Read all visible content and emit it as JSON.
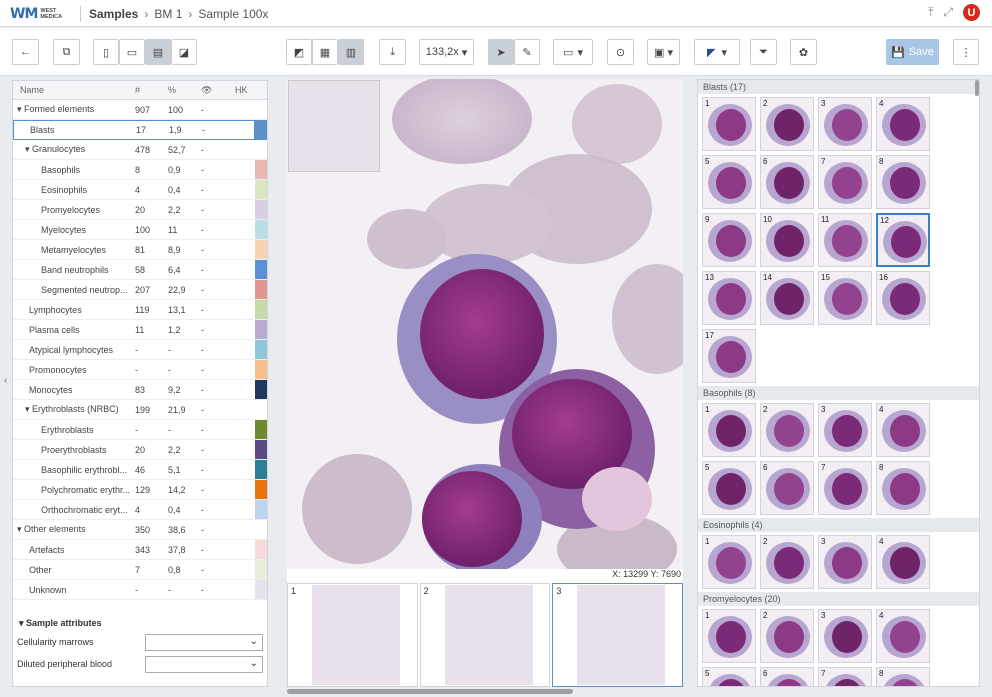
{
  "header": {
    "logo_mark": "WM",
    "logo_line1": "WEST",
    "logo_line2": "MEDICA",
    "crumb_root": "Samples",
    "crumb_mid": "BM 1",
    "crumb_current": "Sample 100x",
    "avatar_initial": "U"
  },
  "toolbar": {
    "zoom": "133,2x",
    "save_label": "Save"
  },
  "table": {
    "headers": {
      "name": "Name",
      "count": "#",
      "percent": "%",
      "visible": "👁",
      "hk": "HK"
    },
    "rows": [
      {
        "indent": 0,
        "caret": "▾",
        "name": "Formed elements",
        "count": "907",
        "percent": "100",
        "vis": "-",
        "color": ""
      },
      {
        "indent": 1,
        "caret": "",
        "name": "Blasts",
        "count": "17",
        "percent": "1,9",
        "vis": "-",
        "color": "#5b8fc8",
        "selected": true
      },
      {
        "indent": 1,
        "caret": "▾",
        "name": "Granulocytes",
        "count": "478",
        "percent": "52,7",
        "vis": "-",
        "color": ""
      },
      {
        "indent": 2,
        "caret": "",
        "name": "Basophils",
        "count": "8",
        "percent": "0,9",
        "vis": "-",
        "color": "#e7b8b4"
      },
      {
        "indent": 2,
        "caret": "",
        "name": "Eosinophils",
        "count": "4",
        "percent": "0,4",
        "vis": "-",
        "color": "#dbe5c0"
      },
      {
        "indent": 2,
        "caret": "",
        "name": "Promyelocytes",
        "count": "20",
        "percent": "2,2",
        "vis": "-",
        "color": "#d9cfe4"
      },
      {
        "indent": 2,
        "caret": "",
        "name": "Myelocytes",
        "count": "100",
        "percent": "11",
        "vis": "-",
        "color": "#b8dfe8"
      },
      {
        "indent": 2,
        "caret": "",
        "name": "Metamyelocytes",
        "count": "81",
        "percent": "8,9",
        "vis": "-",
        "color": "#f5d3b3"
      },
      {
        "indent": 2,
        "caret": "",
        "name": "Band neutrophils",
        "count": "58",
        "percent": "6,4",
        "vis": "-",
        "color": "#5b8fd6"
      },
      {
        "indent": 2,
        "caret": "",
        "name": "Segmented neutrop...",
        "count": "207",
        "percent": "22,9",
        "vis": "-",
        "color": "#e1958e"
      },
      {
        "indent": 1,
        "caret": "",
        "name": "Lymphocytes",
        "count": "119",
        "percent": "13,1",
        "vis": "-",
        "color": "#c5dba7"
      },
      {
        "indent": 1,
        "caret": "",
        "name": "Plasma cells",
        "count": "11",
        "percent": "1,2",
        "vis": "-",
        "color": "#b9abd1"
      },
      {
        "indent": 1,
        "caret": "",
        "name": "Atypical lymphocytes",
        "count": "-",
        "percent": "-",
        "vis": "-",
        "color": "#8cc7dc"
      },
      {
        "indent": 1,
        "caret": "",
        "name": "Promonocytes",
        "count": "-",
        "percent": "-",
        "vis": "-",
        "color": "#f7bd8d"
      },
      {
        "indent": 1,
        "caret": "",
        "name": "Monocytes",
        "count": "83",
        "percent": "9,2",
        "vis": "-",
        "color": "#1f3a5c"
      },
      {
        "indent": 1,
        "caret": "▾",
        "name": "Erythroblasts (NRBC)",
        "count": "199",
        "percent": "21,9",
        "vis": "-",
        "color": ""
      },
      {
        "indent": 2,
        "caret": "",
        "name": "Erythroblasts",
        "count": "-",
        "percent": "-",
        "vis": "-",
        "color": "#6f8a2f"
      },
      {
        "indent": 2,
        "caret": "",
        "name": "Proerythroblasts",
        "count": "20",
        "percent": "2,2",
        "vis": "-",
        "color": "#5e4a82"
      },
      {
        "indent": 2,
        "caret": "",
        "name": "Basophilic erythrobl...",
        "count": "46",
        "percent": "5,1",
        "vis": "-",
        "color": "#2c7f96"
      },
      {
        "indent": 2,
        "caret": "",
        "name": "Polychromatic erythr...",
        "count": "129",
        "percent": "14,2",
        "vis": "-",
        "color": "#e87411"
      },
      {
        "indent": 2,
        "caret": "",
        "name": "Orthochromatic eryt...",
        "count": "4",
        "percent": "0,4",
        "vis": "-",
        "color": "#bcd4ee"
      },
      {
        "indent": 0,
        "caret": "▾",
        "name": "Other elements",
        "count": "350",
        "percent": "38,6",
        "vis": "-",
        "color": ""
      },
      {
        "indent": 1,
        "caret": "",
        "name": "Artefacts",
        "count": "343",
        "percent": "37,8",
        "vis": "-",
        "color": "#f6dcd9"
      },
      {
        "indent": 1,
        "caret": "",
        "name": "Other",
        "count": "7",
        "percent": "0,8",
        "vis": "-",
        "color": "#e7efdc"
      },
      {
        "indent": 1,
        "caret": "",
        "name": "Unknown",
        "count": "-",
        "percent": "-",
        "vis": "-",
        "color": "#e6e3ef"
      }
    ]
  },
  "attributes": {
    "title": "Sample attributes",
    "cellularity_label": "Cellularity marrows",
    "cellularity_value": "",
    "diluted_label": "Diluted peripheral blood",
    "diluted_value": ""
  },
  "viewer": {
    "coords": "X: 13299  Y: 7690"
  },
  "thumbnails": [
    {
      "n": "1"
    },
    {
      "n": "2"
    },
    {
      "n": "3",
      "selected": true
    }
  ],
  "gallery": {
    "sections": [
      {
        "title": "Blasts (17)",
        "count": 17,
        "selected": 12
      },
      {
        "title": "Basophils (8)",
        "count": 8,
        "selected": 0
      },
      {
        "title": "Eosinophils (4)",
        "count": 4,
        "selected": 0
      },
      {
        "title": "Promyelocytes (20)",
        "count": 8,
        "selected": 0
      }
    ]
  }
}
